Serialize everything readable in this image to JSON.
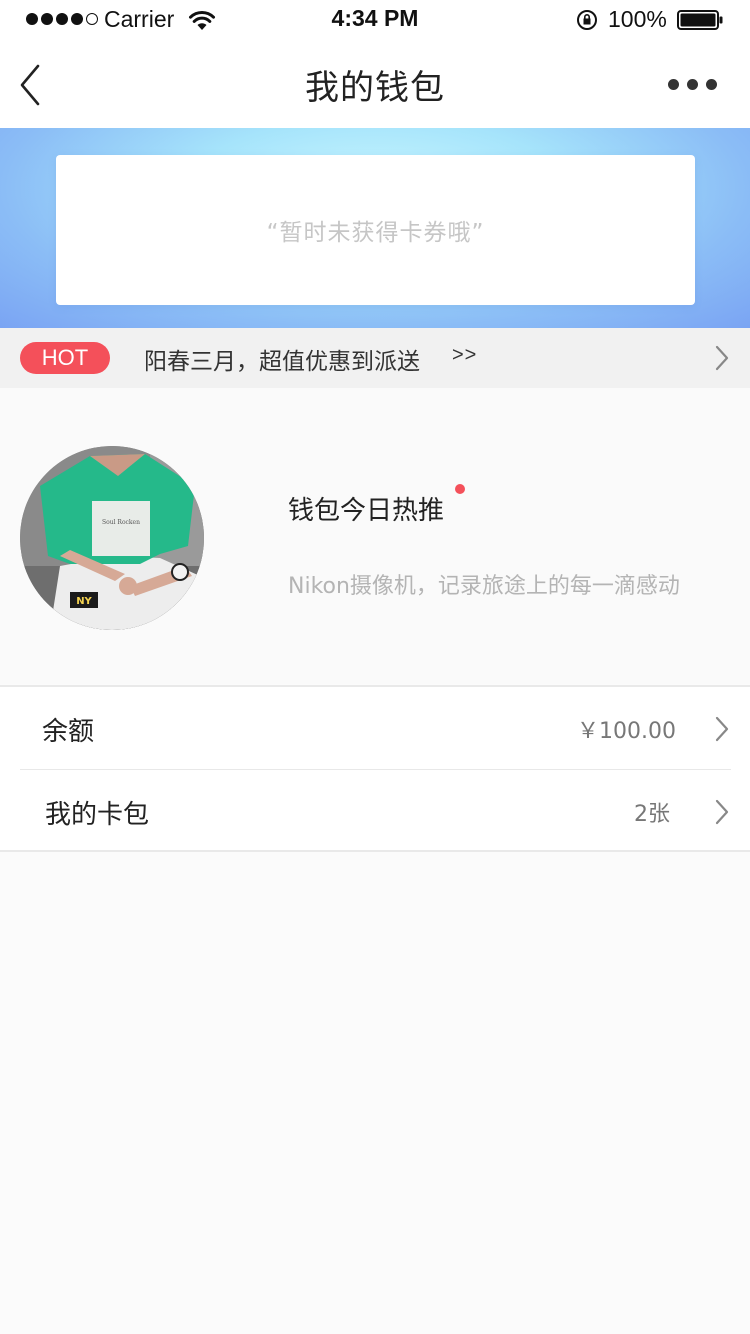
{
  "status_bar": {
    "carrier": "Carrier",
    "time": "4:34 PM",
    "battery": "100%"
  },
  "nav": {
    "title": "我的钱包",
    "back_icon": "chevron-left-icon",
    "more_icon": "more-dots-icon"
  },
  "banner": {
    "empty_text": "“暂时未获得卡券哦”"
  },
  "hot": {
    "badge": "HOT",
    "text": "阳春三月，超值优惠到派送",
    "arrows": ">>"
  },
  "featured": {
    "title": "钱包今日热推",
    "description": "Nikon摄像机，记录旅途上的每一滴感动",
    "avatar_print_text": "Soul Rocken",
    "avatar_print_badge": "NY"
  },
  "list": {
    "balance": {
      "label": "余额",
      "value": "￥100.00"
    },
    "card_pack": {
      "label": "我的卡包",
      "value": "2张"
    }
  },
  "colors": {
    "accent_red": "#f4505a",
    "banner_blue": "#8bbdf6",
    "shirt_green": "#25b98a"
  }
}
